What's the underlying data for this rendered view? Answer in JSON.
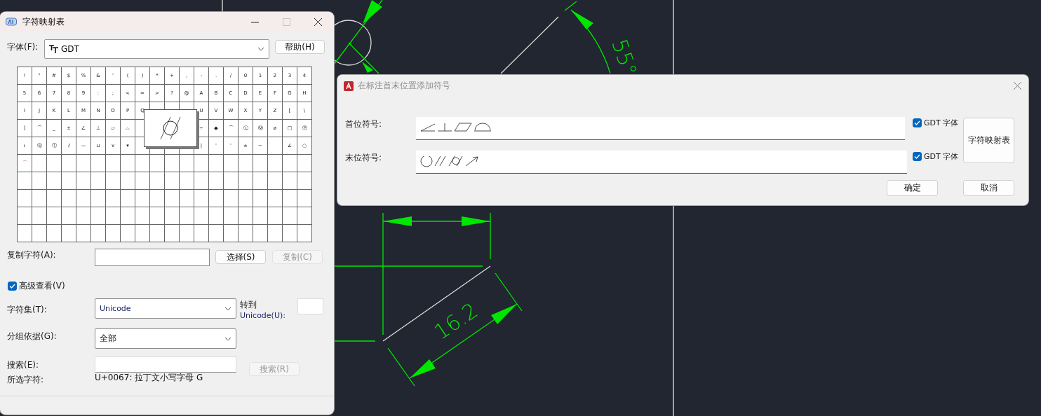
{
  "canvas": {
    "labels": [
      "55°",
      "16.2"
    ]
  },
  "charmap": {
    "title": "字符映射表",
    "font_label": "字体(F):",
    "font": "GDT",
    "help": "帮助(H)",
    "grid": [
      [
        {
          "char": "!"
        },
        {
          "char": "\""
        },
        {
          "char": "#"
        },
        {
          "char": "$"
        },
        {
          "char": "%"
        },
        {
          "char": "&"
        },
        {
          "char": "'"
        },
        {
          "char": "("
        },
        {
          "char": ")"
        },
        {
          "char": "*"
        },
        {
          "char": "+"
        },
        {
          "char": ","
        },
        {
          "char": "-"
        },
        {
          "char": "."
        },
        {
          "char": "/"
        },
        {
          "char": "0"
        },
        {
          "char": "1"
        },
        {
          "char": "2"
        },
        {
          "char": "3"
        },
        {
          "char": "4"
        }
      ],
      [
        {
          "char": "5"
        },
        {
          "char": "6"
        },
        {
          "char": "7"
        },
        {
          "char": "8"
        },
        {
          "char": "9"
        },
        {
          "char": ":"
        },
        {
          "char": ";"
        },
        {
          "char": "<"
        },
        {
          "char": "="
        },
        {
          "char": ">"
        },
        {
          "char": "?"
        },
        {
          "char": "@"
        },
        {
          "char": "A"
        },
        {
          "char": "B"
        },
        {
          "char": "C"
        },
        {
          "char": "D"
        },
        {
          "char": "E"
        },
        {
          "char": "F"
        },
        {
          "char": "G"
        },
        {
          "char": "H"
        }
      ],
      {
        "cells": [
          {
            "char": "I"
          },
          {
            "char": "J"
          },
          {
            "char": "K"
          },
          {
            "char": "L"
          },
          {
            "char": "M"
          },
          {
            "char": "N"
          },
          {
            "char": "O"
          },
          {
            "char": "P"
          },
          {
            "char": "Q"
          }
        ],
        "right_cells": [
          {
            "char": "U"
          },
          {
            "char": "V"
          },
          {
            "char": "W"
          },
          {
            "char": "X"
          },
          {
            "char": "Y"
          },
          {
            "char": "Z"
          },
          {
            "char": "["
          },
          {
            "char": "\\"
          }
        ]
      },
      {
        "cells": [
          {
            "char": "]"
          },
          {
            "char": "⌒"
          },
          {
            "char": "_"
          },
          {
            "char": "±"
          },
          {
            "char": "∠"
          },
          {
            "char": "⊥"
          },
          {
            "char": "▱"
          },
          {
            "char": "⌓"
          }
        ],
        "right_cells": [
          {
            "char": "÷"
          },
          {
            "char": "◆"
          },
          {
            "char": "⌒"
          },
          {
            "char": "Ⓛ"
          },
          {
            "char": "Ⓜ"
          },
          {
            "char": "ø"
          },
          {
            "char": "□"
          },
          {
            "char": "Ⓟ"
          }
        ]
      },
      {
        "cells": [
          {
            "char": "ɩ"
          },
          {
            "char": "Ⓢ"
          },
          {
            "char": "Ⓣ"
          },
          {
            "char": "⫽"
          },
          {
            "char": "—"
          },
          {
            "char": "⊔"
          },
          {
            "char": "∨"
          },
          {
            "char": "▾"
          }
        ],
        "right_cells": [
          {
            "char": "|"
          },
          {
            "char": "'"
          },
          {
            "char": "'"
          },
          {
            "char": "±"
          },
          {
            "char": "−"
          }
        ],
        "end_cells": [
          {
            "char": "∠"
          },
          {
            "char": "○"
          }
        ]
      },
      [
        {
          "char": "⌒"
        }
      ]
    ],
    "copy_label": "复制字符(A):",
    "select_button": "选择(S)",
    "copy_button": {
      "label": "复制(C)",
      "disabled": true
    },
    "advanced": {
      "label": "高级查看(V)",
      "checked": true
    },
    "charset_label": "字符集(T):",
    "charset": "Unicode",
    "goto_label": [
      "转到",
      "Unicode(U):"
    ],
    "group_label": "分组依据(G):",
    "group": "全部",
    "search_label": "搜索(E):",
    "search_button": {
      "label": "搜索(R)",
      "disabled": true
    },
    "selected_label": "所选字符:",
    "selected_char": "U+0067: 拉丁文小写字母 G"
  },
  "symbol_dialog": {
    "title": "在标注首末位置添加符号",
    "rows": [
      {
        "label": "首位符号:",
        "gdt": {
          "label": "GDT 字体",
          "checked": true
        }
      },
      {
        "label": "末位符号:",
        "gdt": {
          "label": "GDT 字体",
          "checked": true
        }
      }
    ],
    "charmap_button": "字符映射表",
    "ok": "确定",
    "cancel": "取消"
  }
}
